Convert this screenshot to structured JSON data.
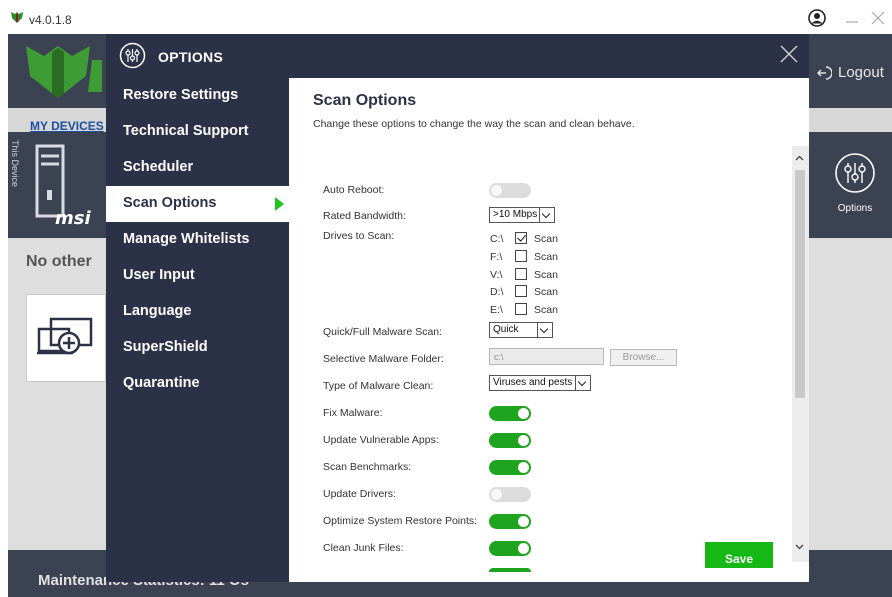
{
  "titlebar": {
    "version": "v4.0.1.8",
    "logo_icon": "shield-logo-icon",
    "user_icon": "user-circle-icon",
    "minimize_icon": "minimize-icon",
    "close_icon": "close-icon"
  },
  "background": {
    "logout_label": "Logout",
    "mydevices_label": "MY DEVICES",
    "this_device_label": "This Device",
    "device_brand": "msi",
    "options_tile_label": "Options",
    "no_other_label": "No other",
    "footer_label": "Maintenance Statistics: 11 Os"
  },
  "modal": {
    "title": "OPTIONS",
    "nav": [
      {
        "label": "Restore Settings",
        "active": false
      },
      {
        "label": "Technical Support",
        "active": false
      },
      {
        "label": "Scheduler",
        "active": false
      },
      {
        "label": "Scan Options",
        "active": true
      },
      {
        "label": "Manage Whitelists",
        "active": false
      },
      {
        "label": "User Input",
        "active": false
      },
      {
        "label": "Language",
        "active": false
      },
      {
        "label": "SuperShield",
        "active": false
      },
      {
        "label": "Quarantine",
        "active": false
      }
    ],
    "content": {
      "heading": "Scan Options",
      "description": "Change these options to change the way the scan and clean behave.",
      "auto_reboot": {
        "label": "Auto Reboot:",
        "on": false
      },
      "rated_bandwidth": {
        "label": "Rated Bandwidth:",
        "value": ">10 Mbps"
      },
      "drives": {
        "label": "Drives to Scan:",
        "scan_label": "Scan",
        "items": [
          {
            "letter": "C:\\",
            "checked": true
          },
          {
            "letter": "F:\\",
            "checked": false
          },
          {
            "letter": "V:\\",
            "checked": false
          },
          {
            "letter": "D:\\",
            "checked": false
          },
          {
            "letter": "E:\\",
            "checked": false
          }
        ]
      },
      "scan_type": {
        "label": "Quick/Full Malware Scan:",
        "value": "Quick"
      },
      "selective_folder": {
        "label": "Selective Malware Folder:",
        "value": "c:\\",
        "browse_label": "Browse..."
      },
      "clean_type": {
        "label": "Type of Malware Clean:",
        "value": "Viruses and pests"
      },
      "toggles": [
        {
          "label": "Fix Malware:",
          "on": true
        },
        {
          "label": "Update Vulnerable Apps:",
          "on": true
        },
        {
          "label": "Scan Benchmarks:",
          "on": true
        },
        {
          "label": "Update Drivers:",
          "on": false
        },
        {
          "label": "Optimize System Restore Points:",
          "on": true
        },
        {
          "label": "Clean Junk Files:",
          "on": true
        }
      ],
      "save_label": "Save"
    }
  },
  "colors": {
    "navy": "#2b3247",
    "green": "#1ea41e",
    "save_green": "#15b815",
    "bg_dark": "#3b4252"
  }
}
